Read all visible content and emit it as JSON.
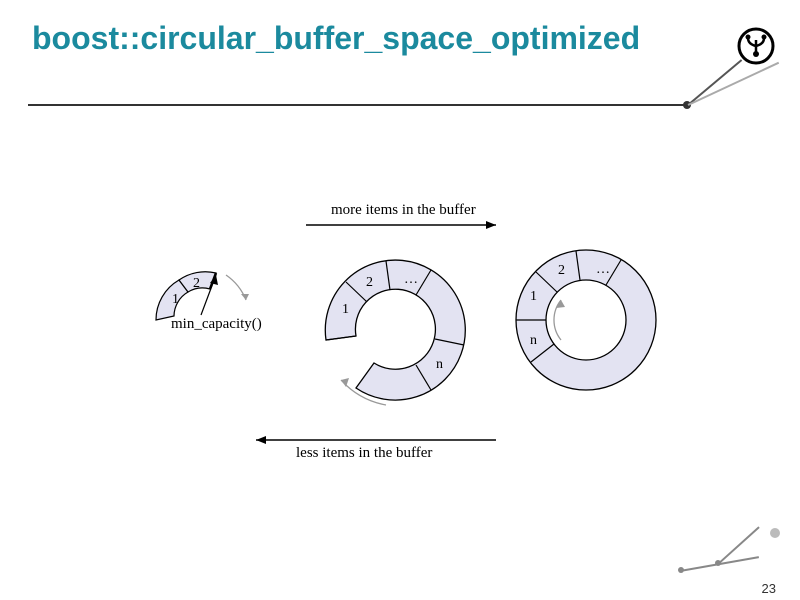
{
  "title": "boost::circular_buffer_space_optimized",
  "page_number": "23",
  "diagram": {
    "top_arrow_label": "more items in the buffer",
    "bottom_arrow_label": "less items in the buffer",
    "min_capacity_label": "min_capacity()",
    "segments": {
      "left": {
        "labels": [
          "1",
          "2"
        ]
      },
      "middle": {
        "labels": [
          "1",
          "2",
          "…",
          "n"
        ]
      },
      "right": {
        "labels": [
          "1",
          "2",
          "…",
          "n"
        ]
      }
    }
  }
}
